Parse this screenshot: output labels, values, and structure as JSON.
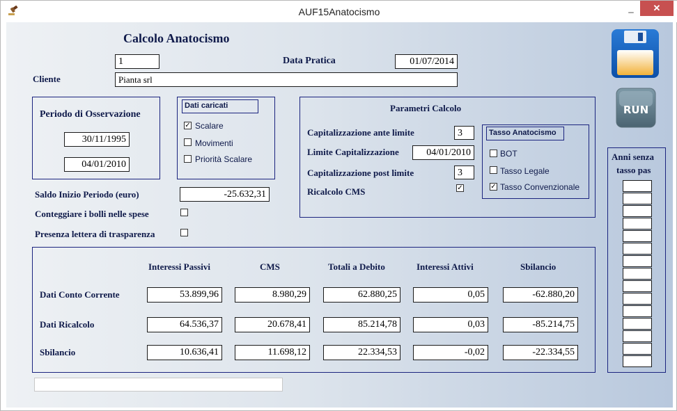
{
  "window": {
    "title": "AUF15Anatocismo",
    "minimize": "_",
    "maximize": "□",
    "close": "✕"
  },
  "header": {
    "title": "Calcolo Anatocismo",
    "id_value": "1",
    "data_pratica_label": "Data Pratica",
    "data_pratica_value": "01/07/2014",
    "cliente_label": "Cliente",
    "cliente_value": "Pianta srl"
  },
  "periodo": {
    "label": "Periodo di Osservazione",
    "start": "30/11/1995",
    "end": "04/01/2010"
  },
  "dati_caricati": {
    "label": "Dati caricati",
    "items": [
      {
        "label": "Scalare",
        "checked": true
      },
      {
        "label": "Movimenti",
        "checked": false
      },
      {
        "label": "Priorità Scalare",
        "checked": false
      }
    ]
  },
  "parametri": {
    "label": "Parametri Calcolo",
    "cap_ante_label": "Capitalizzazione ante limite",
    "cap_ante_value": "3",
    "limite_label": "Limite Capitalizzazione",
    "limite_value": "04/01/2010",
    "cap_post_label": "Capitalizzazione post limite",
    "cap_post_value": "3",
    "ricalcolo_label": "Ricalcolo CMS",
    "ricalcolo_checked": true
  },
  "tasso": {
    "label": "Tasso Anatocismo",
    "items": [
      {
        "label": "BOT",
        "checked": false
      },
      {
        "label": "Tasso Legale",
        "checked": false
      },
      {
        "label": "Tasso Convenzionale",
        "checked": true
      }
    ]
  },
  "saldo": {
    "label": "Saldo Inizio Periodo (euro)",
    "value": "-25.632,31"
  },
  "bolli": {
    "label": "Conteggiare i bolli nelle spese",
    "checked": false
  },
  "lettera": {
    "label": "Presenza lettera di trasparenza",
    "checked": false
  },
  "anni": {
    "label_line1": "Anni senza",
    "label_line2": "tasso pas"
  },
  "results": {
    "columns": [
      "Interessi Passivi",
      "CMS",
      "Totali a Debito",
      "Interessi Attivi",
      "Sbilancio"
    ],
    "rows": [
      {
        "label": "Dati Conto Corrente",
        "values": [
          "53.899,96",
          "8.980,29",
          "62.880,25",
          "0,05",
          "-62.880,20"
        ]
      },
      {
        "label": "Dati Ricalcolo",
        "values": [
          "64.536,37",
          "20.678,41",
          "85.214,78",
          "0,03",
          "-85.214,75"
        ]
      },
      {
        "label": "Sbilancio",
        "values": [
          "10.636,41",
          "11.698,12",
          "22.334,53",
          "-0,02",
          "-22.334,55"
        ]
      }
    ]
  },
  "buttons": {
    "save_icon": "floppy-disk",
    "run_label": "RUN"
  },
  "status": {
    "text": ""
  }
}
